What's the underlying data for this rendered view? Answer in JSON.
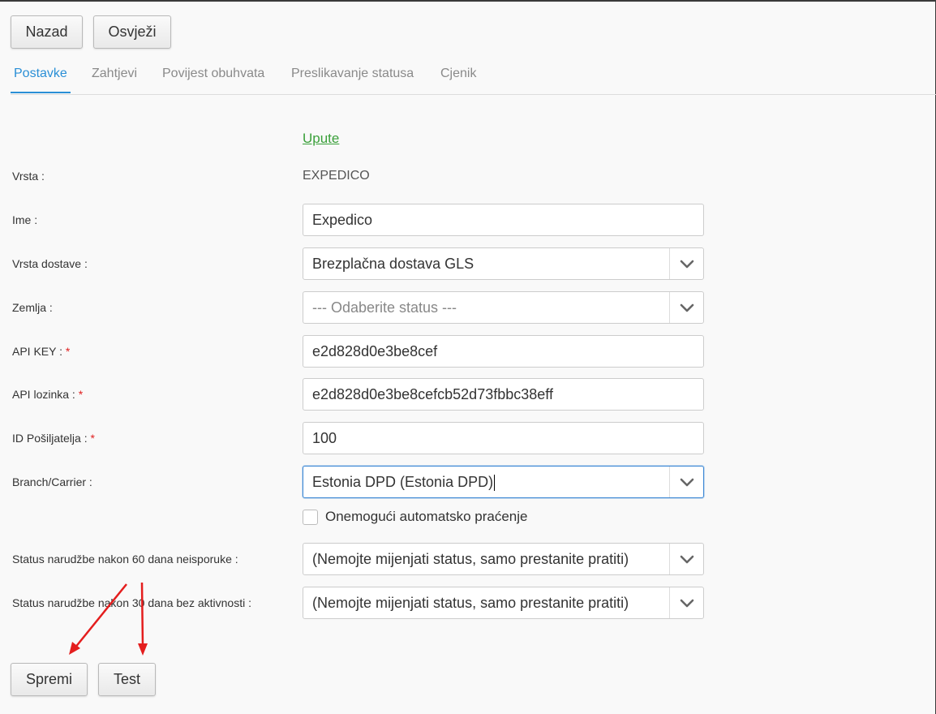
{
  "toolbar": {
    "back_label": "Nazad",
    "refresh_label": "Osvježi"
  },
  "tabs": [
    {
      "label": "Postavke",
      "active": true
    },
    {
      "label": "Zahtjevi",
      "active": false
    },
    {
      "label": "Povijest obuhvata",
      "active": false
    },
    {
      "label": "Preslikavanje statusa",
      "active": false
    },
    {
      "label": "Cjenik",
      "active": false
    }
  ],
  "form": {
    "instructions_link": "Upute",
    "required_mark": "*",
    "type": {
      "label": "Vrsta :",
      "value": "EXPEDICO"
    },
    "name": {
      "label": "Ime :",
      "value": "Expedico"
    },
    "delivery_type": {
      "label": "Vrsta dostave :",
      "value": "Brezplačna dostava GLS"
    },
    "country": {
      "label": "Zemlja :",
      "placeholder": "--- Odaberite status ---"
    },
    "api_key": {
      "label": "API KEY :",
      "value": "e2d828d0e3be8cef"
    },
    "api_password": {
      "label": "API lozinka :",
      "value": "e2d828d0e3be8cefcb52d73fbbc38eff"
    },
    "sender_id": {
      "label": "ID Pošiljatelja :",
      "value": "100"
    },
    "branch": {
      "label": "Branch/Carrier :",
      "value": "Estonia DPD (Estonia DPD)"
    },
    "disable_tracking": {
      "label": "Onemogući automatsko praćenje",
      "checked": false
    },
    "status_60": {
      "label": "Status narudžbe nakon 60 dana neisporuke :",
      "value": "(Nemojte mijenjati status, samo prestanite pratiti)"
    },
    "status_30": {
      "label": "Status narudžbe nakon 30 dana bez aktivnosti :",
      "value": "(Nemojte mijenjati status, samo prestanite pratiti)"
    }
  },
  "actions": {
    "save_label": "Spremi",
    "test_label": "Test"
  },
  "colors": {
    "accent": "#2a8fd6",
    "link": "#3aa03a",
    "required": "#e02020",
    "annotation_arrow": "#e41e1e"
  },
  "icons": {
    "select_chevron": "chevron-down-icon",
    "annotation": "red-arrow-icon"
  }
}
